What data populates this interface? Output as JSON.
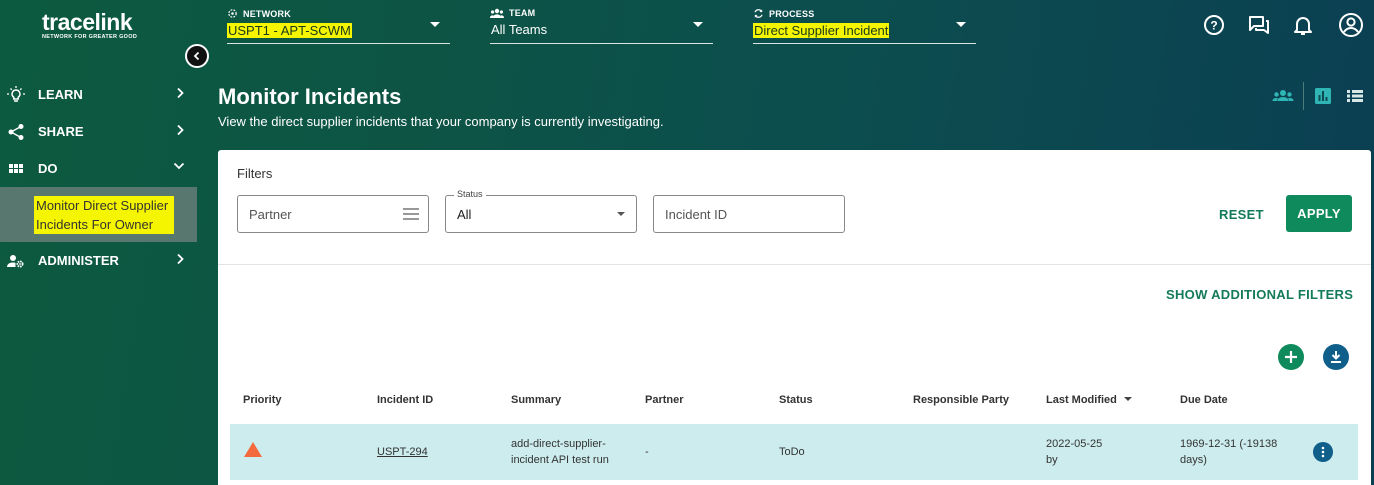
{
  "brand": {
    "name": "tracelink",
    "tagline": "NETWORK FOR GREATER GOOD"
  },
  "topbar": {
    "network": {
      "label": "NETWORK",
      "value": "USPT1 - APT-SCWM"
    },
    "team": {
      "label": "TEAM",
      "value": "All Teams"
    },
    "process": {
      "label": "PROCESS",
      "value": "Direct Supplier Incident"
    },
    "icons": [
      "help-icon",
      "chat-icon",
      "bell-icon",
      "account-icon"
    ]
  },
  "sidebar": {
    "items": [
      {
        "label": "LEARN",
        "icon": "lightbulb-icon"
      },
      {
        "label": "SHARE",
        "icon": "share-icon"
      },
      {
        "label": "DO",
        "icon": "grid-icon"
      },
      {
        "label": "ADMINISTER",
        "icon": "user-gear-icon"
      }
    ],
    "sub_item": "Monitor Direct Supplier Incidents For Owner"
  },
  "page": {
    "title": "Monitor Incidents",
    "subtitle": "View the direct supplier incidents that your company is currently investigating."
  },
  "filters": {
    "heading": "Filters",
    "partner_placeholder": "Partner",
    "status_label": "Status",
    "status_value": "All",
    "incident_placeholder": "Incident ID",
    "reset": "RESET",
    "apply": "APPLY",
    "show_more": "SHOW ADDITIONAL FILTERS"
  },
  "table": {
    "columns": [
      "Priority",
      "Incident ID",
      "Summary",
      "Partner",
      "Status",
      "Responsible Party",
      "Last Modified",
      "Due Date"
    ],
    "rows": [
      {
        "priority": "high",
        "incident_id": "USPT-294",
        "summary": "add-direct-supplier-incident API test run",
        "partner": "-",
        "status": "ToDo",
        "responsible_party": "",
        "last_modified": "2022-05-25",
        "last_modified_by": "by",
        "due_date": "1969-12-31 (-19138 days)"
      }
    ]
  },
  "colors": {
    "accent": "#0f8a5c",
    "highlight": "#f5f500",
    "row": "#cdecee",
    "priority": "#f26a3d"
  }
}
